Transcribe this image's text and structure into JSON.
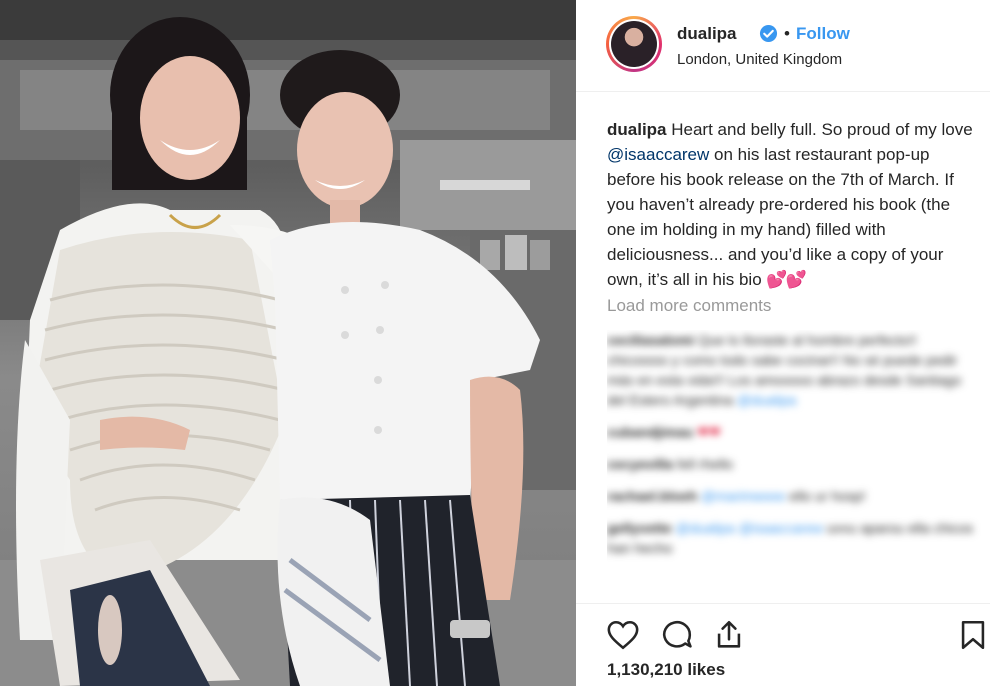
{
  "post": {
    "username": "dualipa",
    "follow_label": "Follow",
    "separator": "•",
    "location": "London, United Kingdom",
    "verified_icon": "verified-badge-icon",
    "accent_color": "#3897f0"
  },
  "caption": {
    "username": "dualipa",
    "text_before_mention": "Heart and belly full. So proud of my love",
    "mention": "@isaaccarew",
    "text_after_mention": "on his last restaurant pop-up before his book release on the 7th of March. If you haven’t already pre-ordered his book (the one im holding in my hand) filled with deliciousness... and you’d like a copy of your own, it’s all in his bio",
    "emoji": "💕💕"
  },
  "load_more_label": "Load more comments",
  "comments": [
    {
      "user": "ceciliasalomi",
      "text": "Que lo lloraste al hombre perfecto!! chicossss y como todo sabe cocinar!! No sé puede pedir más en esta vida!!! Los amooooo abrazo desde Santiago del Estero Argentina",
      "mention": "@dualipa"
    },
    {
      "user": "cubandjimau",
      "text": "",
      "mention": ""
    },
    {
      "user": "cecyevilla",
      "text": "fell rhello",
      "mention": ""
    },
    {
      "user": "rachael.bloeh",
      "text": "ello ur hosp!",
      "mention": "@marimeeee"
    },
    {
      "user": "gellyvette",
      "text": "uvvu aparou ella chicos han hecho",
      "mention": "@dualipa @isaaccarew"
    }
  ],
  "actions": {
    "like_icon": "heart-icon",
    "comment_icon": "comment-icon",
    "share_icon": "share-icon",
    "save_icon": "bookmark-icon"
  },
  "likes_label": "1,130,210 likes"
}
